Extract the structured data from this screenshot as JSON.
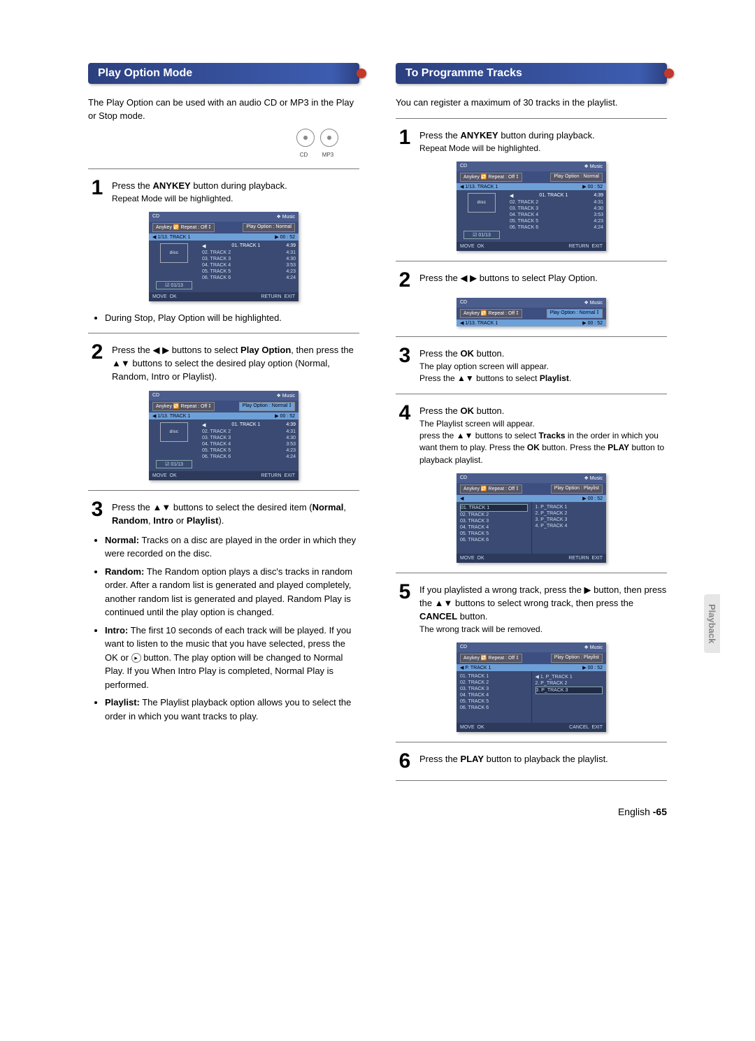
{
  "section_tab": "Playback",
  "page_footer": {
    "lang": "English",
    "num": "-65"
  },
  "left": {
    "header": "Play Option Mode",
    "intro": "The Play Option can be used with an audio CD or MP3 in the Play or Stop mode.",
    "disc_labels": [
      "CD",
      "MP3"
    ],
    "step1": {
      "n": "1",
      "body_pre": "Press the ",
      "bold1": "ANYKEY",
      "body_mid": " button during playback.",
      "sub": "Repeat Mode will be highlighted."
    },
    "note_after_shot1": "During Stop, Play Option will be highlighted.",
    "step2": {
      "n": "2",
      "body": "Press the ◀ ▶ buttons to select ",
      "bold1": "Play Option",
      "body2": ", then press the ▲▼ buttons to select the desired play option (Normal, Random, Intro or Playlist)."
    },
    "step3": {
      "n": "3",
      "body": "Press the ▲▼ buttons to select the desired item (",
      "bold1": "Normal",
      "c1": ", ",
      "bold2": "Random",
      "c2": ", ",
      "bold3": "Intro",
      "c3": " or ",
      "bold4": "Playlist",
      "c4": ")."
    },
    "bullets": [
      {
        "lead": "Normal:",
        "text": " Tracks on a disc are played in the order in which they were recorded on the disc."
      },
      {
        "lead": "Random:",
        "text": " The Random option plays a disc's tracks in random order. After a random list is generated and played completely, another random list is generated and played. Random Play is continued until the play option is changed."
      },
      {
        "lead": "Intro:",
        "text_a": " The first 10 seconds of each track will be played. If you want to listen to the music that you have selected, press the OK or ",
        "text_b": " button. The play option will be changed to Normal Play. If you When Intro Play is completed, Normal Play is performed."
      },
      {
        "lead": "Playlist:",
        "text": " The Playlist playback option allows you to select the order in which you want tracks to play."
      }
    ]
  },
  "right": {
    "header": "To Programme Tracks",
    "intro": "You can register a maximum of 30 tracks in the playlist.",
    "step1": {
      "n": "1",
      "body_pre": "Press the ",
      "bold1": "ANYKEY",
      "body_mid": " button during playback.",
      "sub": "Repeat Mode will be highlighted."
    },
    "step2": {
      "n": "2",
      "body": "Press the ◀ ▶ buttons to select Play Option."
    },
    "step3": {
      "n": "3",
      "body_pre": "Press the ",
      "bold1": "OK",
      "body_mid": " button.",
      "sub1": "The play option screen will appear.",
      "sub2_pre": "Press the ▲▼ buttons to select ",
      "sub2_bold": "Playlist",
      "sub2_post": "."
    },
    "step4": {
      "n": "4",
      "body_pre": "Press the ",
      "bold1": "OK",
      "body_mid": " button.",
      "sub1": "The Playlist screen will appear.",
      "sub2_pre": "press the ▲▼ buttons to select ",
      "sub2_bold": "Tracks",
      "sub2_mid": " in the order in which you want them to play. Press the ",
      "sub2_bold2": "OK",
      "sub2_mid2": " button. Press the ",
      "sub2_bold3": "PLAY",
      "sub2_post": " button to playback playlist."
    },
    "step5": {
      "n": "5",
      "body_pre": "If you playlisted a wrong track, press the ▶ button, then press the ▲▼ buttons to select wrong track, then press the ",
      "bold1": "CANCEL",
      "body_mid": " button.",
      "sub": "The wrong track will be removed."
    },
    "step6": {
      "n": "6",
      "body_pre": "Press the ",
      "bold1": "PLAY",
      "body_mid": " button to playback the playlist."
    }
  },
  "shot_common": {
    "title": "CD",
    "music": "❖ Music",
    "repeat": "Anykey  🔁 Repeat : Off  ⭥",
    "option_normal": "Play Option : Normal",
    "option_normal_hi": "Play Option : Normal ⭥",
    "option_playlist": "Play Option : Playlist",
    "sel_left_113": "◀ 1/13. TRACK 1",
    "sel_left_p": "◀ P. TRACK 1",
    "sel_left_blank": "◀",
    "sel_right_time": "▶   00 : 52",
    "track_idx": "☑ 01/13",
    "tracks": [
      {
        "n": "01. TRACK 1",
        "t": "4:39"
      },
      {
        "n": "02. TRACK 2",
        "t": "4:31"
      },
      {
        "n": "03. TRACK 3",
        "t": "4:30"
      },
      {
        "n": "04. TRACK 4",
        "t": "3:53"
      },
      {
        "n": "05. TRACK 5",
        "t": "4:23"
      },
      {
        "n": "06. TRACK 6",
        "t": "4:24"
      }
    ],
    "programme": [
      "1. P_TRACK 1",
      "2. P_TRACK 2",
      "3. P_TRACK 3",
      "4. P_TRACK 4"
    ],
    "programme3": [
      "1. P_TRACK 1",
      "2. P_TRACK 2",
      "3. P_TRACK 3"
    ],
    "footer_move": "MOVE",
    "footer_ok": "OK",
    "footer_return": "RETURN",
    "footer_cancel": "CANCEL",
    "footer_exit": "EXIT",
    "cd_logo": "disc"
  }
}
